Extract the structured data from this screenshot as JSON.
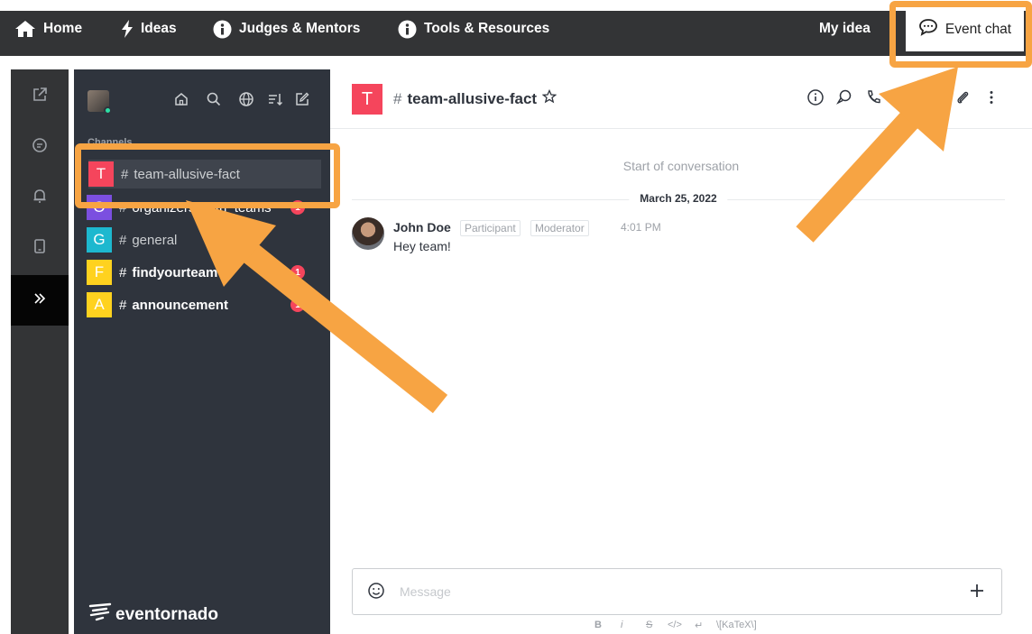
{
  "topnav": {
    "items": [
      {
        "label": "Home",
        "icon": "home-icon"
      },
      {
        "label": "Ideas",
        "icon": "lightning-icon"
      },
      {
        "label": "Judges & Mentors",
        "icon": "info-icon"
      },
      {
        "label": "Tools & Resources",
        "icon": "info-icon"
      }
    ],
    "my_idea": "My idea",
    "event_chat": "Event chat"
  },
  "sidebar": {
    "section_label": "Channels",
    "channels": [
      {
        "initial": "T",
        "name": "team-allusive-fact",
        "color": "#f5455c",
        "badge": ""
      },
      {
        "initial": "O",
        "name": "organizers_with_teams",
        "color": "#7b4fe0",
        "badge": "1"
      },
      {
        "initial": "G",
        "name": "general",
        "color": "#1db8cf",
        "badge": ""
      },
      {
        "initial": "F",
        "name": "findyourteam",
        "color": "#ffd21f",
        "badge": "1"
      },
      {
        "initial": "A",
        "name": "announcement",
        "color": "#ffd21f",
        "badge": "1"
      }
    ],
    "brand": "eventornado"
  },
  "room": {
    "initial": "T",
    "name": "team-allusive-fact",
    "start_text": "Start of conversation",
    "date": "March 25, 2022",
    "messages": [
      {
        "author": "John Doe",
        "roles": [
          "Participant",
          "Moderator"
        ],
        "time": "4:01 PM",
        "text": "Hey team!"
      }
    ]
  },
  "composer": {
    "placeholder": "Message",
    "formatting": [
      "B",
      "i",
      "S",
      "</>",
      "↵",
      "\\[KaTeX\\]"
    ]
  },
  "colors": {
    "topbar": "#333436",
    "sidebar": "#2f343d",
    "highlight": "#f7a443",
    "accent_red": "#f5455c"
  }
}
